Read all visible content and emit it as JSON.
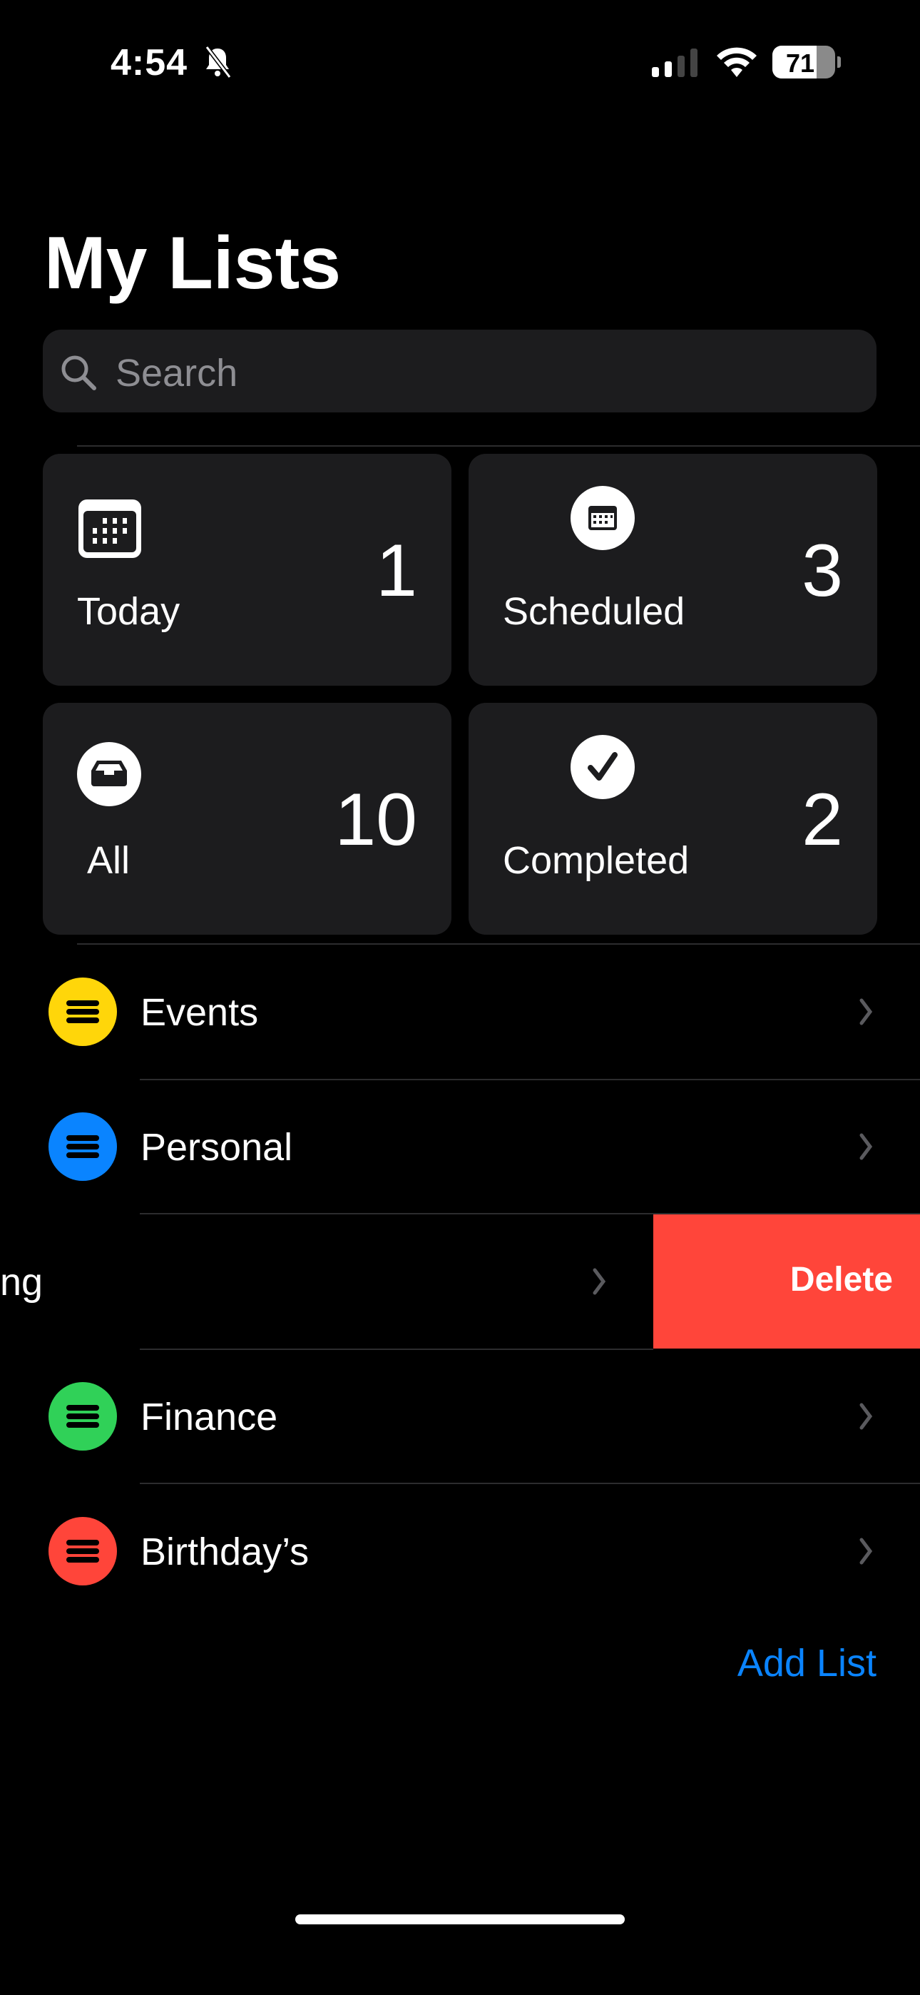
{
  "status_bar": {
    "time": "4:54",
    "battery": "71",
    "silent": true,
    "signal_bars": 2,
    "icons": [
      "bell-slash-icon",
      "cellular-signal-icon",
      "wifi-icon",
      "battery-icon"
    ]
  },
  "header": {
    "title": "My Lists"
  },
  "search": {
    "placeholder": "Search"
  },
  "smart_lists": [
    {
      "label": "Today",
      "count": "1",
      "icon": "calendar-icon"
    },
    {
      "label": "Scheduled",
      "count": "3",
      "icon": "calendar-circle-icon"
    },
    {
      "label": "All",
      "count": "10",
      "icon": "tray-icon"
    },
    {
      "label": "Completed",
      "count": "2",
      "icon": "checkmark-circle-icon"
    }
  ],
  "lists": [
    {
      "name": "Events",
      "color": "#ffd60a"
    },
    {
      "name": "Personal",
      "color": "#0a84ff"
    },
    {
      "name": "ng",
      "color": "",
      "swiped": true
    },
    {
      "name": "Finance",
      "color": "#30d158"
    },
    {
      "name": "Birthday’s",
      "color": "#ff453a"
    }
  ],
  "swipe_action": {
    "label": "Delete",
    "color": "#ff453a"
  },
  "footer": {
    "add_list": "Add List"
  }
}
